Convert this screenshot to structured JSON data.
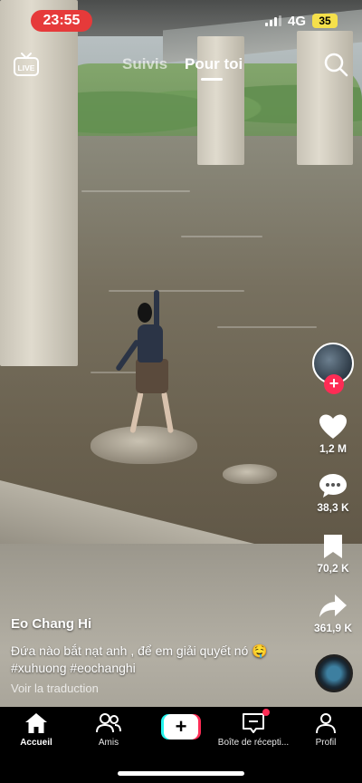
{
  "status_bar": {
    "time": "23:55",
    "network": "4G",
    "battery": "35"
  },
  "top_nav": {
    "live_label": "LIVE",
    "tabs": [
      {
        "label": "Suivis"
      },
      {
        "label": "Pour toi",
        "active": true
      }
    ]
  },
  "actions": {
    "likes": "1,2 M",
    "comments": "38,3 K",
    "saves": "70,2 K",
    "shares": "361,9 K"
  },
  "post": {
    "author": "Eo Chang Hi",
    "caption": "Đứa nào bắt nạt anh , để em giải quyết nó 🤤#xuhuong #eochanghi",
    "translate": "Voir la traduction"
  },
  "bottom_nav": {
    "items": [
      {
        "label": "Accueil",
        "icon": "home-icon",
        "active": true
      },
      {
        "label": "Amis",
        "icon": "friends-icon"
      },
      {
        "label": "",
        "icon": "create-icon"
      },
      {
        "label": "Boîte de récepti...",
        "icon": "inbox-icon"
      },
      {
        "label": "Profil",
        "icon": "profile-icon"
      }
    ]
  },
  "colors": {
    "accent": "#fe2c55",
    "cyan": "#25f4ee",
    "time_pill": "#e63a3a",
    "battery": "#f5e04b"
  }
}
